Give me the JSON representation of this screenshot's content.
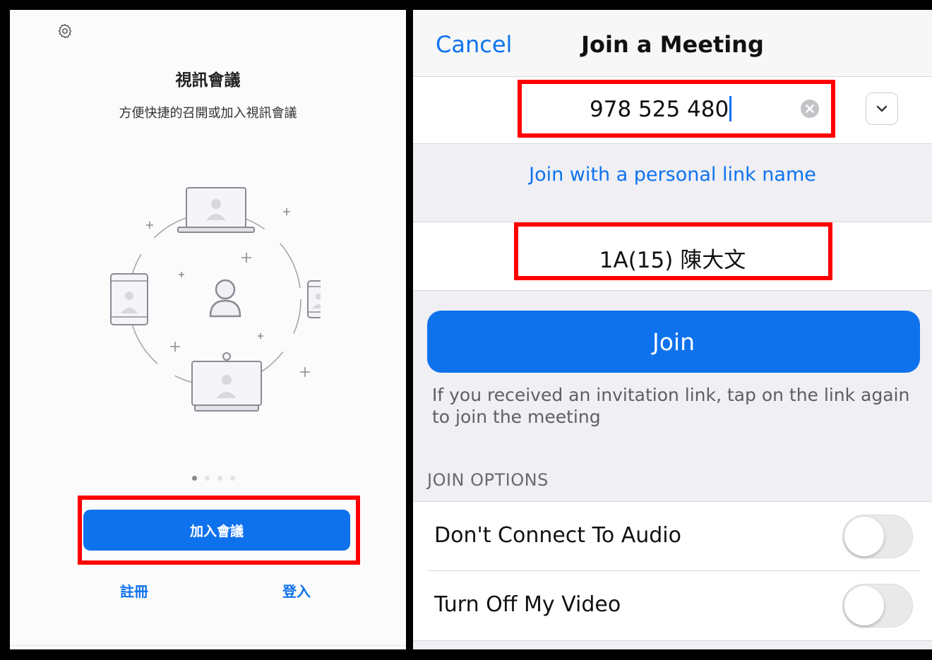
{
  "left_panel": {
    "title": "視訊會議",
    "subtitle": "方便快捷的召開或加入視訊會議",
    "pagination": {
      "current": 1,
      "total": 4
    },
    "join_button": "加入會議",
    "signup_link": "註冊",
    "signin_link": "登入",
    "icons": [
      "settings-gear-icon"
    ]
  },
  "right_panel": {
    "nav": {
      "cancel": "Cancel",
      "title": "Join a Meeting"
    },
    "meeting_id": {
      "value": "978 525 480"
    },
    "personal_link": "Join with a personal link name",
    "name_field": {
      "value": "1A(15) 陳大文"
    },
    "join_button": "Join",
    "hint": "If you received an invitation link, tap on the link again to join the meeting",
    "options_header": "JOIN OPTIONS",
    "options": [
      {
        "label": "Don't Connect To Audio",
        "enabled": false
      },
      {
        "label": "Turn Off My Video",
        "enabled": false
      }
    ]
  },
  "colors": {
    "accent": "#0e72ed",
    "highlight": "#ff0000",
    "background": "#efeff4"
  }
}
